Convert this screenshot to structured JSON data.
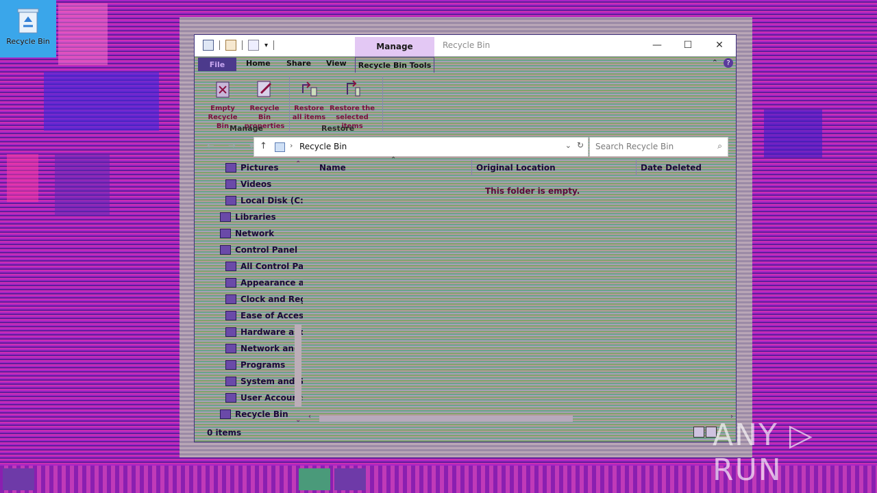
{
  "desktop": {
    "recycle_bin_label": "Recycle Bin"
  },
  "window": {
    "title": "Recycle Bin",
    "manage_tab": "Manage",
    "minimize_glyph": "—",
    "maximize_glyph": "☐",
    "close_glyph": "✕"
  },
  "ribbon": {
    "tabs": {
      "file": "File",
      "home": "Home",
      "share": "Share",
      "view": "View",
      "tools": "Recycle Bin Tools"
    },
    "buttons": {
      "empty_line1": "Empty",
      "empty_line2": "Recycle Bin",
      "props_line1": "Recycle Bin",
      "props_line2": "properties",
      "restore_all_line1": "Restore",
      "restore_all_line2": "all items",
      "restore_sel_line1": "Restore the",
      "restore_sel_line2": "selected items"
    },
    "groups": {
      "manage": "Manage",
      "restore": "Restore"
    }
  },
  "address": {
    "path": "Recycle Bin",
    "search_placeholder": "Search Recycle Bin"
  },
  "nav": {
    "items": [
      {
        "label": "Pictures"
      },
      {
        "label": "Videos"
      },
      {
        "label": "Local Disk (C:)"
      },
      {
        "label": "Libraries"
      },
      {
        "label": "Network"
      },
      {
        "label": "Control Panel"
      },
      {
        "label": "All Control Par"
      },
      {
        "label": "Appearance an"
      },
      {
        "label": "Clock and Regi"
      },
      {
        "label": "Ease of Access"
      },
      {
        "label": "Hardware and"
      },
      {
        "label": "Network and Ir"
      },
      {
        "label": "Programs"
      },
      {
        "label": "System and Se"
      },
      {
        "label": "User Accounts"
      },
      {
        "label": "Recycle Bin"
      }
    ]
  },
  "content": {
    "columns": {
      "name": "Name",
      "original_location": "Original Location",
      "date_deleted": "Date Deleted"
    },
    "empty_message": "This folder is empty."
  },
  "status": {
    "count": "0 items"
  },
  "watermark": "ANY ▷ RUN"
}
